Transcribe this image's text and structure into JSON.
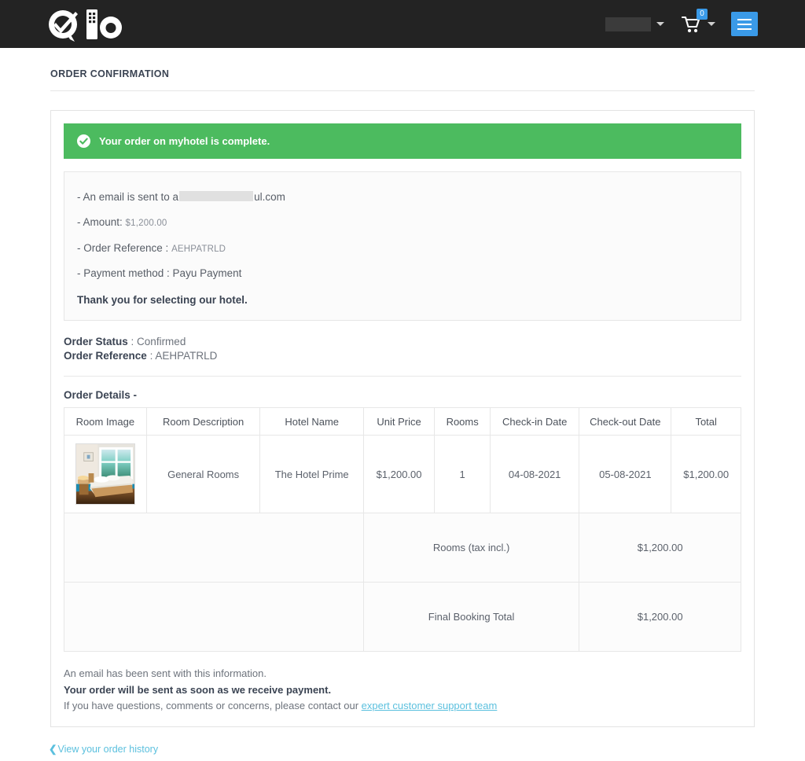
{
  "header": {
    "logo_text": "Qio",
    "logo_icon": "qio-logo",
    "user": {
      "name_redacted": "",
      "caret_icon": "caret-down-icon"
    },
    "cart": {
      "icon": "shopping-cart-icon",
      "count": "0",
      "caret_icon": "caret-down-icon"
    },
    "menu_button_icon": "hamburger-menu-icon",
    "brand_color": "#3a9ae8",
    "bar_color": "#232323"
  },
  "page": {
    "title": "ORDER CONFIRMATION"
  },
  "alert": {
    "icon": "check-circle-icon",
    "message": "Your order on myhotel is complete.",
    "color": "#4cbb5f"
  },
  "info": {
    "email_prefix": "- An email is sent to a",
    "email_suffix": "ul.com",
    "amount_label": "- Amount:",
    "amount_value": "$1,200.00",
    "reference_label": "- Order Reference :",
    "reference_value": "AEHPATRLD",
    "payment_label": "- Payment method : Payu Payment",
    "thank_you": "Thank you for selecting our hotel."
  },
  "status": {
    "order_status_label": "Order Status",
    "order_status_value": ": Confirmed",
    "order_reference_label": "Order Reference",
    "order_reference_value": ": AEHPATRLD"
  },
  "details": {
    "heading": "Order Details -",
    "columns": [
      "Room Image",
      "Room Description",
      "Hotel Name",
      "Unit Price",
      "Rooms",
      "Check-in Date",
      "Check-out Date",
      "Total"
    ],
    "rows": [
      {
        "image_alt": "hotel-room-photo",
        "description": "General Rooms",
        "hotel": "The Hotel Prime",
        "unit_price": "$1,200.00",
        "rooms": "1",
        "check_in": "04-08-2021",
        "check_out": "05-08-2021",
        "total": "$1,200.00"
      }
    ],
    "totals": [
      {
        "label": "Rooms (tax incl.)",
        "value": "$1,200.00"
      },
      {
        "label": "Final Booking Total",
        "value": "$1,200.00"
      }
    ]
  },
  "footer": {
    "line1": "An email has been sent with this information.",
    "line2": "Your order will be sent as soon as we receive payment.",
    "line3_prefix": "If you have questions, comments or concerns, please contact our ",
    "support_link": "expert customer support team",
    "back_link": "View your order history",
    "link_color": "#5bc0de"
  }
}
